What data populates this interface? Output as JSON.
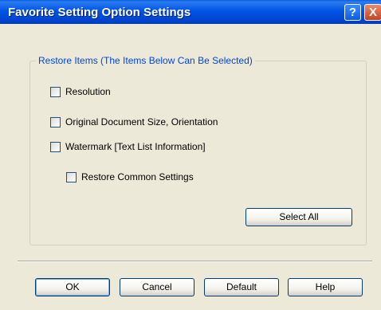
{
  "window": {
    "title": "Favorite Setting Option Settings",
    "help_glyph": "?",
    "close_glyph": "X"
  },
  "group": {
    "legend": "Restore Items (The Items Below Can Be Selected)",
    "items": [
      {
        "label": "Resolution",
        "checked": false
      },
      {
        "label": "Original Document Size, Orientation",
        "checked": false
      },
      {
        "label": "Watermark [Text List Information]",
        "checked": false
      },
      {
        "label": "Restore Common Settings",
        "checked": false
      }
    ],
    "select_all_label": "Select All"
  },
  "buttons": {
    "ok": "OK",
    "cancel": "Cancel",
    "default": "Default",
    "help": "Help"
  },
  "colors": {
    "titlebar": "#0055E5",
    "legend_text": "#0046D5",
    "dialog_bg": "#ECE9D8",
    "close_button": "#C8401E"
  }
}
